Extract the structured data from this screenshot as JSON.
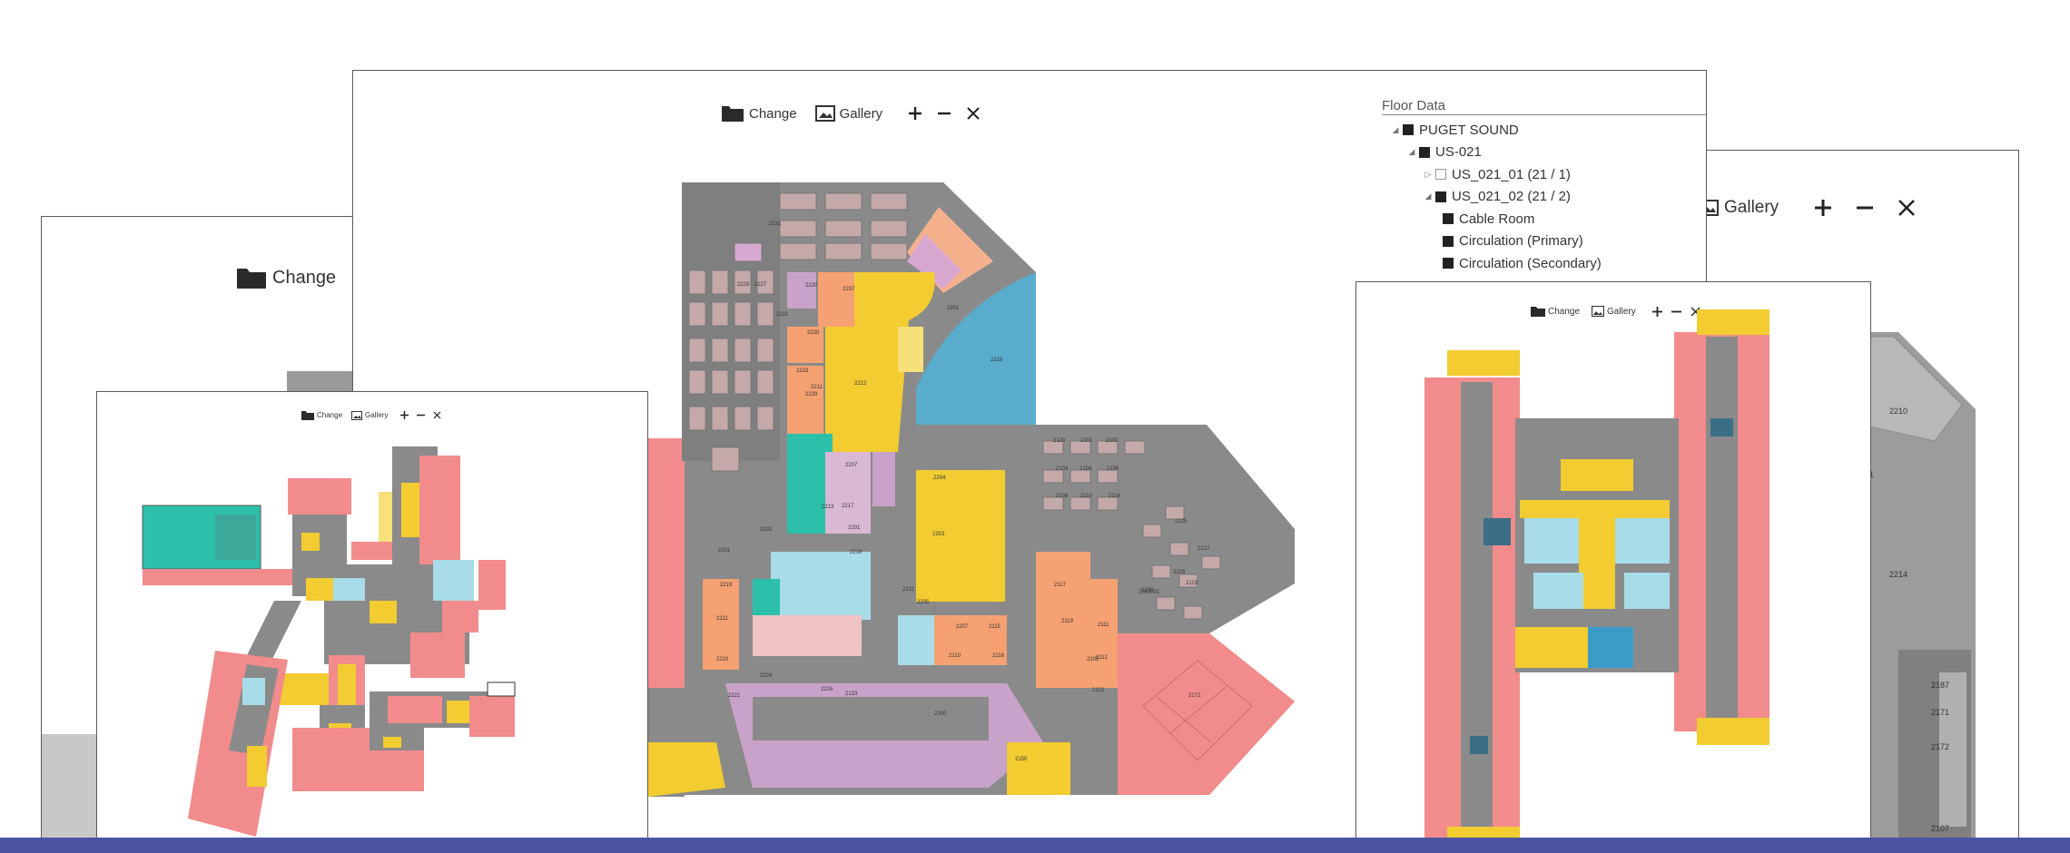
{
  "panels": {
    "back_left": {
      "toolbar": {
        "change_label": "Change"
      }
    },
    "back_right": {
      "toolbar": {
        "gallery_label": "Gallery"
      },
      "room_labels": [
        "2301",
        "2214",
        "2210",
        "2187",
        "2171",
        "2172",
        "2107"
      ]
    },
    "left": {
      "toolbar": {
        "change_label": "Change",
        "gallery_label": "Gallery"
      }
    },
    "main": {
      "toolbar": {
        "change_label": "Change",
        "gallery_label": "Gallery"
      },
      "room_labels": [
        "2231",
        "2227",
        "2229",
        "2230",
        "2231",
        "2235",
        "2237",
        "2233",
        "2211",
        "2301",
        "2216",
        "2212",
        "2229",
        "2207",
        "2213",
        "2217",
        "2201",
        "2202",
        "2218",
        "2201",
        "2219",
        "2211",
        "2220",
        "2221",
        "2224",
        "2226",
        "2133",
        "2131",
        "2203",
        "2204",
        "2205",
        "2207",
        "2210",
        "2115",
        "2116",
        "2117",
        "2119",
        "2105",
        "2111",
        "2112",
        "2113",
        "2100",
        "2120",
        "2101",
        "2102",
        "2103",
        "2104",
        "2106",
        "2108",
        "2110",
        "2114",
        "2125",
        "2127",
        "2129",
        "2115",
        "CW2001",
        "2172",
        "2200",
        "2150"
      ]
    },
    "right": {
      "toolbar": {
        "change_label": "Change",
        "gallery_label": "Gallery"
      }
    }
  },
  "floor_data": {
    "title": "Floor Data",
    "tree": [
      {
        "label": "PUGET SOUND",
        "level": 0,
        "expanded": true,
        "checked": true
      },
      {
        "label": "US-021",
        "level": 1,
        "expanded": true,
        "checked": true
      },
      {
        "label": "US_021_01 (21 / 1)",
        "level": 2,
        "expanded": false,
        "checked": false
      },
      {
        "label": "US_021_02 (21 / 2)",
        "level": 2,
        "expanded": true,
        "checked": true
      },
      {
        "label": "Cable Room",
        "level": 3,
        "checked": true
      },
      {
        "label": "Circulation (Primary)",
        "level": 3,
        "checked": true
      },
      {
        "label": "Circulation (Secondary)",
        "level": 3,
        "checked": true
      }
    ]
  },
  "colors": {
    "office": "#f28b8b",
    "circulation": "#8c8c8c",
    "support": "#f2cc30",
    "meeting": "#f5a172",
    "collab": "#2cc0aa",
    "utility": "#5aaccc",
    "amenity": "#c9a2c9",
    "light_blue": "#a8dce8",
    "accent_bar": "#4b54a1"
  },
  "icons": [
    "folder-icon",
    "gallery-icon",
    "zoom-in-icon",
    "zoom-out-icon",
    "fit-icon"
  ]
}
